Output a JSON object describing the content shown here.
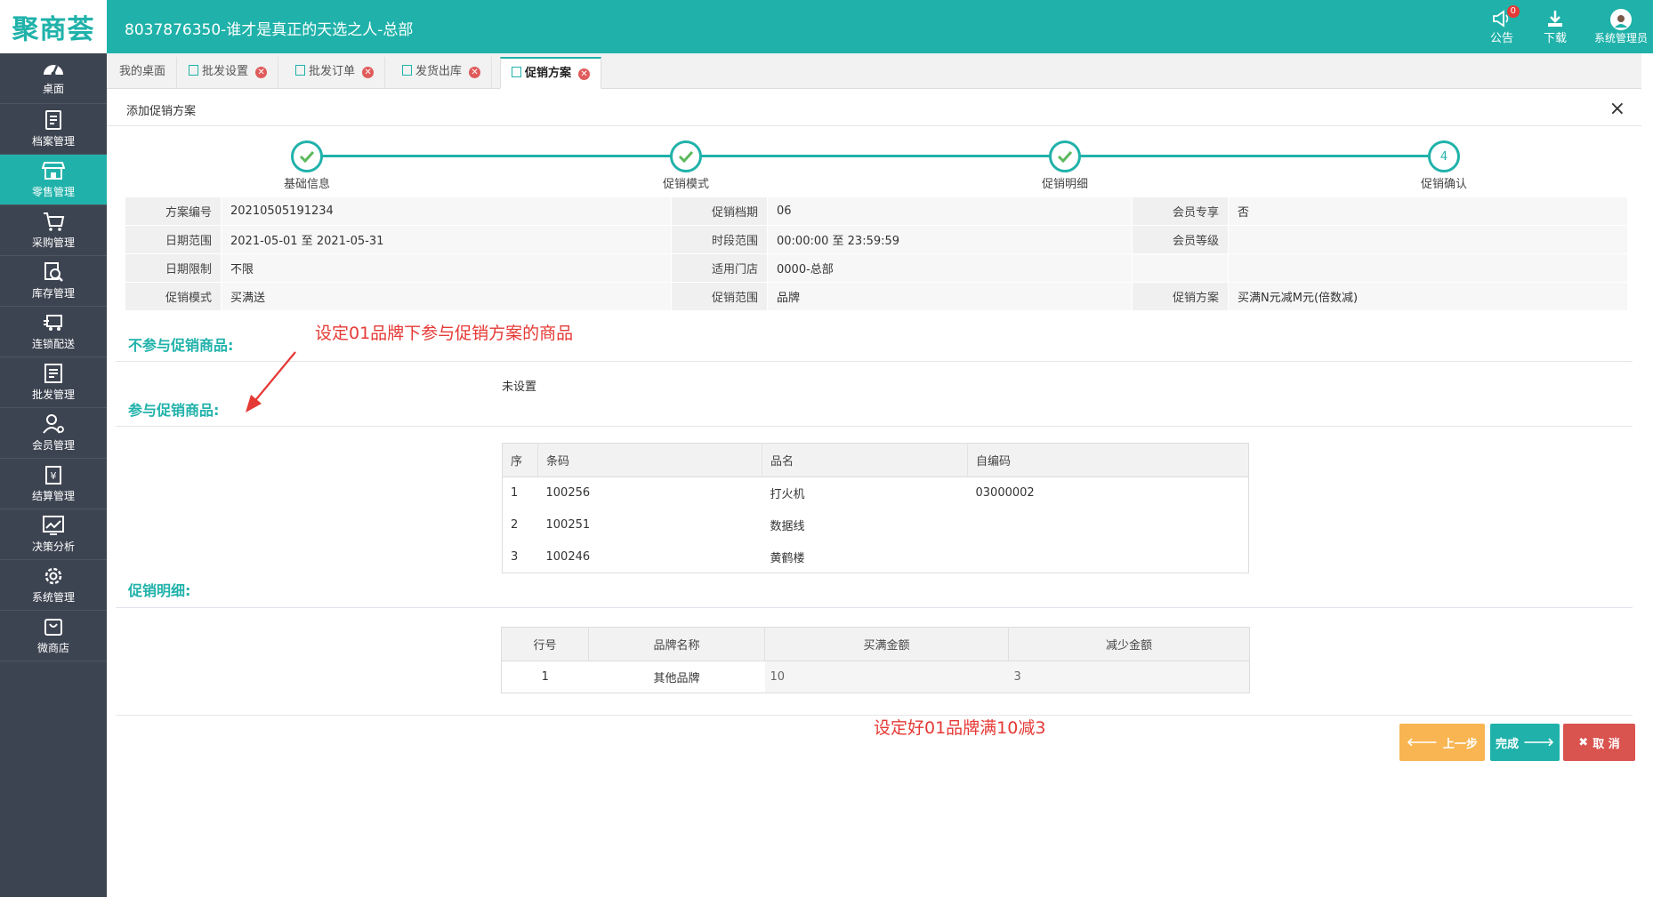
{
  "app": {
    "logo_text": "聚商荟",
    "header_title": "8037876350-谁才是真正的天选之人-总部"
  },
  "top_actions": {
    "notice_label": "公告",
    "notice_badge": "0",
    "download_label": "下载",
    "user_label": "系统管理员"
  },
  "sidebar": {
    "items": [
      {
        "label": "桌面",
        "icon": "dashboard-icon"
      },
      {
        "label": "档案管理",
        "icon": "archive-icon"
      },
      {
        "label": "零售管理",
        "icon": "store-icon",
        "active": true
      },
      {
        "label": "采购管理",
        "icon": "purchase-icon"
      },
      {
        "label": "库存管理",
        "icon": "inventory-icon"
      },
      {
        "label": "连锁配送",
        "icon": "delivery-icon"
      },
      {
        "label": "批发管理",
        "icon": "wholesale-icon"
      },
      {
        "label": "会员管理",
        "icon": "member-icon"
      },
      {
        "label": "结算管理",
        "icon": "settlement-icon"
      },
      {
        "label": "决策分析",
        "icon": "analysis-icon"
      },
      {
        "label": "系统管理",
        "icon": "settings-icon"
      },
      {
        "label": "微商店",
        "icon": "shop-bag-icon"
      }
    ]
  },
  "tabs": [
    {
      "label": "我的桌面",
      "closable": false
    },
    {
      "label": "批发设置",
      "closable": true
    },
    {
      "label": "批发订单",
      "closable": true
    },
    {
      "label": "发货出库",
      "closable": true
    },
    {
      "label": "促销方案",
      "closable": true,
      "active": true
    }
  ],
  "dialog": {
    "title": "添加促销方案",
    "close_symbol": "×"
  },
  "steps": [
    {
      "label": "基础信息",
      "state": "done"
    },
    {
      "label": "促销模式",
      "state": "done"
    },
    {
      "label": "促销明细",
      "state": "done"
    },
    {
      "label": "促销确认",
      "state": "current",
      "number": "4"
    }
  ],
  "info": {
    "plan_no_label": "方案编号",
    "plan_no": "20210505191234",
    "period_label": "促销档期",
    "period": "06",
    "member_only_label": "会员专享",
    "member_only": "否",
    "date_range_label": "日期范围",
    "date_range": "2021-05-01 至 2021-05-31",
    "time_range_label": "时段范围",
    "time_range": "00:00:00 至 23:59:59",
    "member_level_label": "会员等级",
    "member_level": "",
    "date_limit_label": "日期限制",
    "date_limit": "不限",
    "store_label": "适用门店",
    "store": "0000-总部",
    "mode_label": "促销模式",
    "mode": "买满送",
    "scope_label": "促销范围",
    "scope": "品牌",
    "scheme_label": "促销方案",
    "scheme": "买满N元减M元(倍数减)"
  },
  "sections": {
    "excluded_title": "不参与促销商品:",
    "excluded_value": "未设置",
    "included_title": "参与促销商品:",
    "detail_title": "促销明细:"
  },
  "annotations": {
    "top": "设定01品牌下参与促销方案的商品",
    "bottom": "设定好01品牌满10减3"
  },
  "goods_table": {
    "headers": [
      "序",
      "条码",
      "品名",
      "自编码"
    ],
    "rows": [
      [
        "1",
        "100256",
        "打火机",
        "03000002"
      ],
      [
        "2",
        "100251",
        "数据线",
        ""
      ],
      [
        "3",
        "100246",
        "黄鹤楼",
        ""
      ]
    ]
  },
  "detail_table": {
    "headers": [
      "行号",
      "品牌名称",
      "买满金额",
      "减少金额"
    ],
    "rows": [
      [
        "1",
        "其他品牌",
        "10",
        "3"
      ]
    ]
  },
  "buttons": {
    "prev": "上一步",
    "finish": "完成",
    "cancel": "取 消"
  },
  "colors": {
    "primary": "#20b2aa",
    "sidebar": "#3d4451",
    "prev": "#f8b551",
    "finish": "#20b2aa",
    "cancel": "#d9534f",
    "annotation": "#e53935"
  }
}
